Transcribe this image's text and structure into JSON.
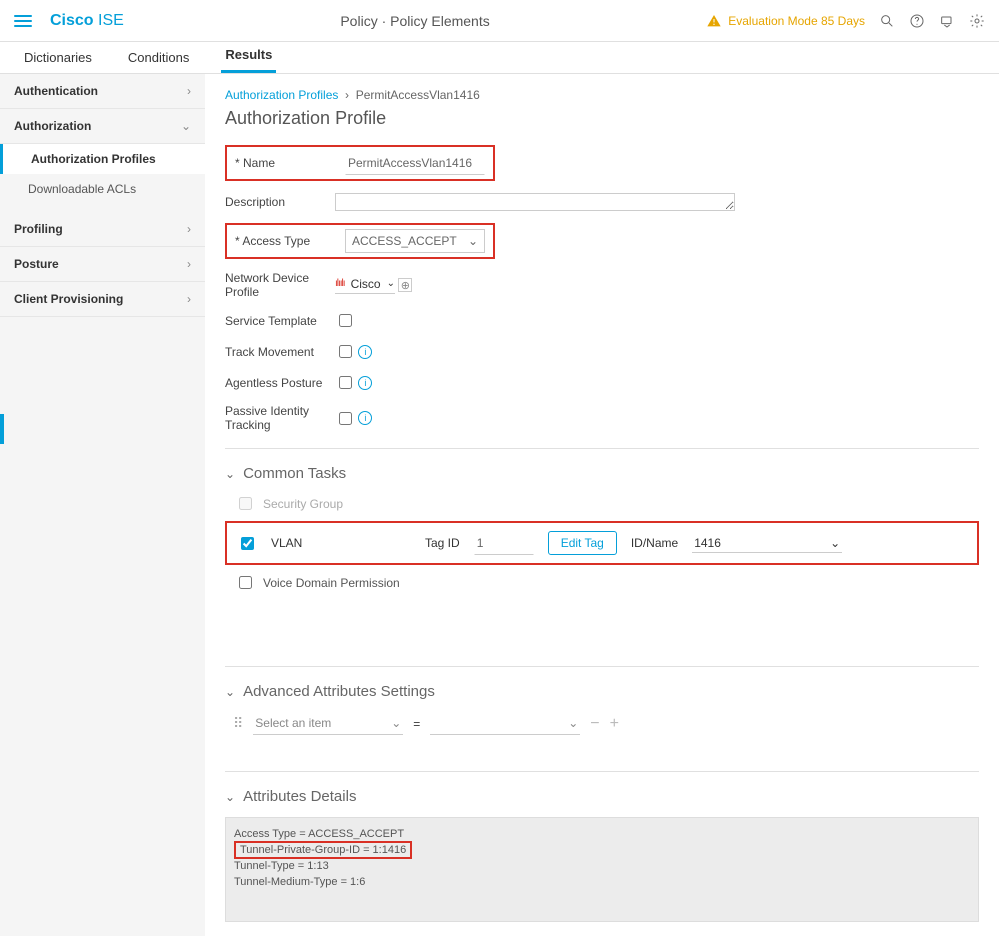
{
  "header": {
    "brand1": "Cisco",
    "brand2": "ISE",
    "title": "Policy · Policy Elements",
    "warn": "Evaluation Mode 85 Days"
  },
  "tabs": [
    {
      "label": "Dictionaries"
    },
    {
      "label": "Conditions"
    },
    {
      "label": "Results"
    }
  ],
  "sidebar": {
    "auth": "Authentication",
    "authorization": "Authorization",
    "ap": "Authorization Profiles",
    "dacl": "Downloadable ACLs",
    "profiling": "Profiling",
    "posture": "Posture",
    "cp": "Client Provisioning"
  },
  "breadcrumb": {
    "parent": "Authorization Profiles",
    "current": "PermitAccessVlan1416"
  },
  "title": "Authorization Profile",
  "form": {
    "name_label": "Name",
    "name_value": "PermitAccessVlan1416",
    "desc_label": "Description",
    "access_label": "Access Type",
    "access_value": "ACCESS_ACCEPT",
    "ndp_label": "Network Device Profile",
    "ndp_value": "Cisco",
    "st_label": "Service Template",
    "tm_label": "Track Movement",
    "ap_label": "Agentless Posture",
    "pit_label": "Passive Identity Tracking"
  },
  "sections": {
    "common": "Common Tasks",
    "sg": "Security Group",
    "vlan": "VLAN",
    "tagid_label": "Tag ID",
    "tagid_value": "1",
    "edittag": "Edit Tag",
    "idname_label": "ID/Name",
    "idname_value": "1416",
    "voice": "Voice Domain Permission",
    "adv": "Advanced Attributes Settings",
    "select_item": "Select an item",
    "attr": "Attributes Details"
  },
  "attrs": {
    "l1": "Access Type = ACCESS_ACCEPT",
    "l2": "Tunnel-Private-Group-ID = 1:1416",
    "l3": "Tunnel-Type = 1:13",
    "l4": "Tunnel-Medium-Type = 1:6"
  }
}
